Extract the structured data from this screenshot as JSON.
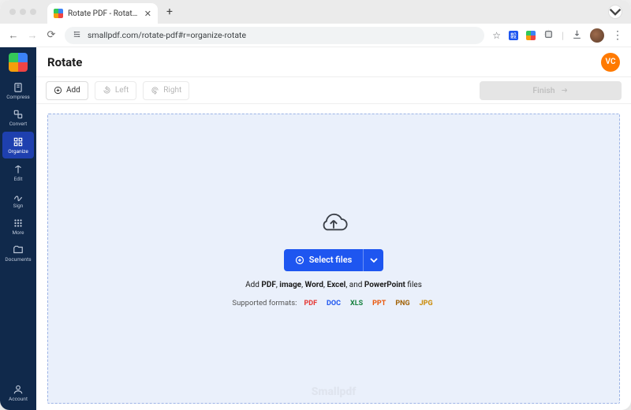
{
  "browser": {
    "tab_title": "Rotate PDF - Rotate Pages O",
    "url": "smallpdf.com/rotate-pdf#r=organize-rotate"
  },
  "header": {
    "page_title": "Rotate",
    "avatar_initials": "VC"
  },
  "sidebar": {
    "items": [
      {
        "id": "compress",
        "label": "Compress"
      },
      {
        "id": "convert",
        "label": "Convert"
      },
      {
        "id": "organize",
        "label": "Organize"
      },
      {
        "id": "edit",
        "label": "Edit"
      },
      {
        "id": "sign",
        "label": "Sign"
      },
      {
        "id": "more",
        "label": "More"
      },
      {
        "id": "documents",
        "label": "Documents"
      }
    ],
    "account_label": "Account"
  },
  "toolbar": {
    "add_label": "Add",
    "left_label": "Left",
    "right_label": "Right",
    "finish_label": "Finish"
  },
  "dropzone": {
    "select_files_label": "Select files",
    "hint_prefix": "Add ",
    "hint_parts": {
      "pdf": "PDF",
      "c1": ", ",
      "image": "image",
      "c2": ", ",
      "word": "Word",
      "c3": ", ",
      "excel": "Excel",
      "c4": ", and ",
      "ppt": "PowerPoint"
    },
    "hint_suffix": " files",
    "supported_label": "Supported formats:",
    "formats": {
      "pdf": "PDF",
      "doc": "DOC",
      "xls": "XLS",
      "ppt": "PPT",
      "png": "PNG",
      "jpg": "JPG"
    },
    "watermark": "Smallpdf"
  }
}
